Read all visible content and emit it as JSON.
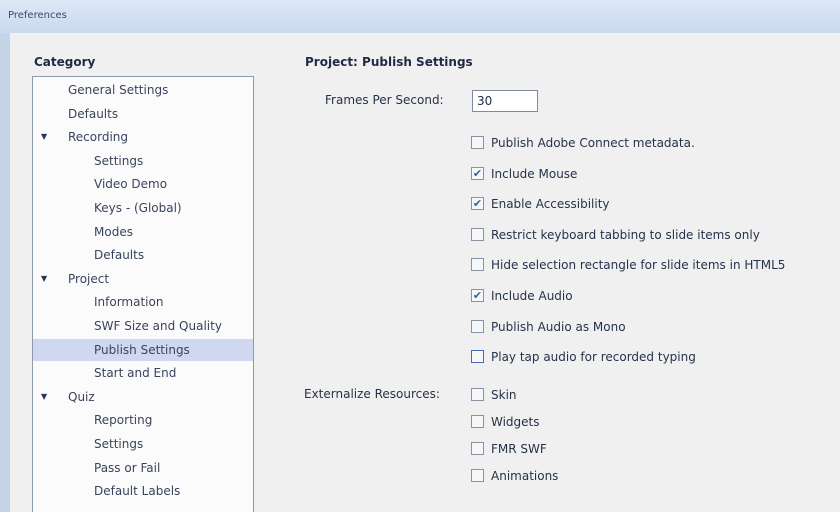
{
  "window": {
    "title": "Preferences"
  },
  "category": {
    "header": "Category",
    "items": [
      {
        "label": "General Settings",
        "level": 1,
        "expander": false,
        "selected": false
      },
      {
        "label": "Defaults",
        "level": 1,
        "expander": false,
        "selected": false
      },
      {
        "label": "Recording",
        "level": 1,
        "expander": true,
        "selected": false
      },
      {
        "label": "Settings",
        "level": 2,
        "expander": false,
        "selected": false
      },
      {
        "label": "Video Demo",
        "level": 2,
        "expander": false,
        "selected": false
      },
      {
        "label": "Keys - (Global)",
        "level": 2,
        "expander": false,
        "selected": false
      },
      {
        "label": "Modes",
        "level": 2,
        "expander": false,
        "selected": false
      },
      {
        "label": "Defaults",
        "level": 2,
        "expander": false,
        "selected": false
      },
      {
        "label": "Project",
        "level": 1,
        "expander": true,
        "selected": false
      },
      {
        "label": "Information",
        "level": 2,
        "expander": false,
        "selected": false
      },
      {
        "label": "SWF Size and Quality",
        "level": 2,
        "expander": false,
        "selected": false
      },
      {
        "label": "Publish Settings",
        "level": 2,
        "expander": false,
        "selected": true
      },
      {
        "label": "Start and End",
        "level": 2,
        "expander": false,
        "selected": false
      },
      {
        "label": "Quiz",
        "level": 1,
        "expander": true,
        "selected": false
      },
      {
        "label": "Reporting",
        "level": 2,
        "expander": false,
        "selected": false
      },
      {
        "label": "Settings",
        "level": 2,
        "expander": false,
        "selected": false
      },
      {
        "label": "Pass or Fail",
        "level": 2,
        "expander": false,
        "selected": false
      },
      {
        "label": "Default Labels",
        "level": 2,
        "expander": false,
        "selected": false
      }
    ]
  },
  "publish": {
    "title": "Project: Publish Settings",
    "fps_label": "Frames Per Second:",
    "fps_value": "30",
    "options": [
      {
        "label": "Publish Adobe Connect metadata.",
        "checked": false
      },
      {
        "label": "Include Mouse",
        "checked": true
      },
      {
        "label": "Enable Accessibility",
        "checked": true
      },
      {
        "label": "Restrict keyboard tabbing to slide items only",
        "checked": false
      },
      {
        "label": "Hide selection rectangle for slide items in HTML5",
        "checked": false
      },
      {
        "label": "Include Audio",
        "checked": true
      },
      {
        "label": "Publish Audio as Mono",
        "checked": false
      },
      {
        "label": "Play tap audio for recorded typing",
        "checked": false,
        "focused": true
      }
    ],
    "externalize_label": "Externalize Resources:",
    "resources": [
      {
        "label": "Skin",
        "checked": false
      },
      {
        "label": "Widgets",
        "checked": false
      },
      {
        "label": "FMR SWF",
        "checked": false
      },
      {
        "label": "Animations",
        "checked": false
      }
    ]
  },
  "icons": {
    "expander": "triangle-down-icon",
    "check": "checkmark-icon"
  }
}
